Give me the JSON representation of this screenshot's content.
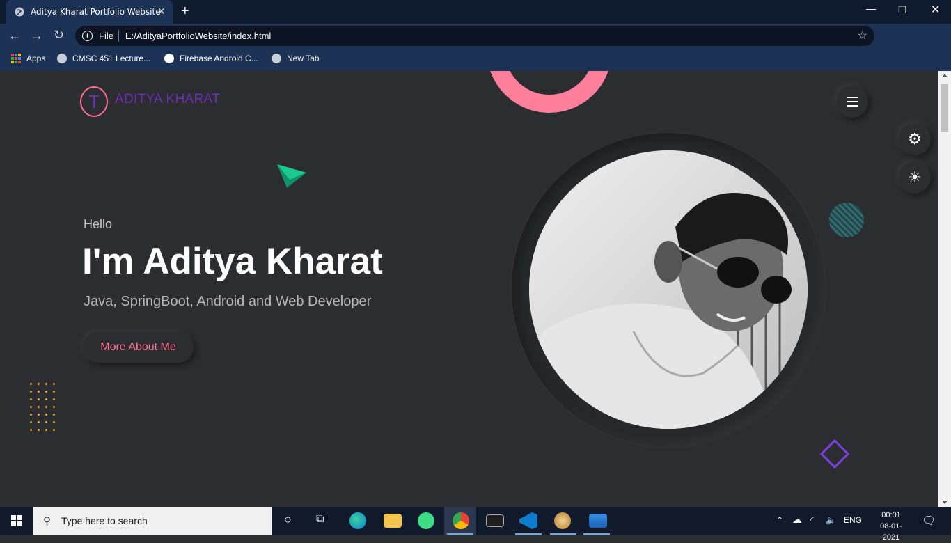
{
  "browser": {
    "tab_title": "Aditya Kharat Portfolio Website",
    "tab_close": "✕",
    "new_tab": "+",
    "address_scheme_label": "File",
    "url": "E:/AdityaPortfolioWebsite/index.html",
    "bookmarks": [
      {
        "label": "Apps"
      },
      {
        "label": "CMSC 451 Lecture..."
      },
      {
        "label": "Firebase Android C..."
      },
      {
        "label": "New Tab"
      }
    ]
  },
  "page": {
    "logo_letter": "T",
    "logo_text": "ADITYA KHARAT",
    "greeting": "Hello",
    "headline": "I'm Aditya Kharat",
    "subheadline": "Java, SpringBoot, Android and Web Developer",
    "cta_label": "More About Me",
    "accent_pink": "#ff6f91",
    "accent_purple": "#6a2fb0",
    "background": "#2b2d31"
  },
  "taskbar": {
    "search_placeholder": "Type here to search",
    "language": "ENG",
    "time": "00:01",
    "date": "08-01-2021"
  }
}
